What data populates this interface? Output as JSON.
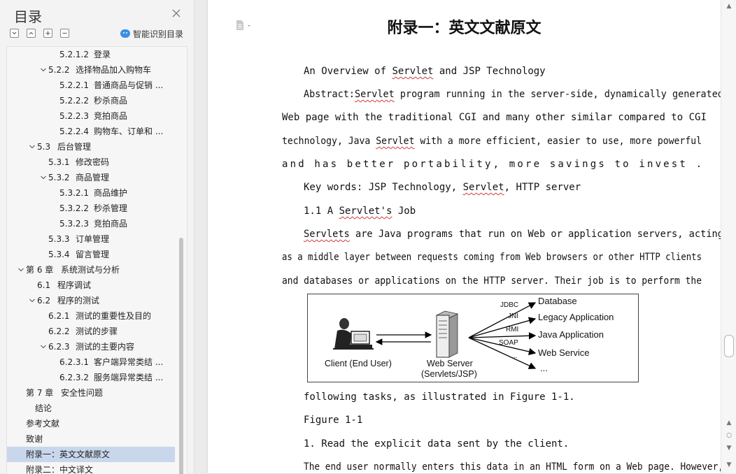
{
  "sidebar": {
    "title": "目录",
    "close_icon": "close-icon",
    "smart_toc_label": "智能识别目录",
    "toolbar_icons": [
      "collapse-all-icon",
      "expand-all-icon",
      "add-heading-icon",
      "remove-heading-icon"
    ],
    "items": [
      {
        "num": "5.2.1.2",
        "label": "登录",
        "level": 4,
        "chevron": ""
      },
      {
        "num": "5.2.2",
        "label": "选择物品加入购物车",
        "level": 3,
        "chevron": "down"
      },
      {
        "num": "5.2.2.1",
        "label": "普通商品与促销 ...",
        "level": 4,
        "chevron": ""
      },
      {
        "num": "5.2.2.2",
        "label": "秒杀商品",
        "level": 4,
        "chevron": ""
      },
      {
        "num": "5.2.2.3",
        "label": "竞拍商品",
        "level": 4,
        "chevron": ""
      },
      {
        "num": "5.2.2.4",
        "label": "购物车、订单和 ...",
        "level": 4,
        "chevron": ""
      },
      {
        "num": "5.3",
        "label": "后台管理",
        "level": 2,
        "chevron": "down"
      },
      {
        "num": "5.3.1",
        "label": "修改密码",
        "level": 3,
        "chevron": ""
      },
      {
        "num": "5.3.2",
        "label": "商品管理",
        "level": 3,
        "chevron": "down"
      },
      {
        "num": "5.3.2.1",
        "label": "商品维护",
        "level": 4,
        "chevron": ""
      },
      {
        "num": "5.3.2.2",
        "label": "秒杀管理",
        "level": 4,
        "chevron": ""
      },
      {
        "num": "5.3.2.3",
        "label": "竞拍商品",
        "level": 4,
        "chevron": ""
      },
      {
        "num": "5.3.3",
        "label": "订单管理",
        "level": 3,
        "chevron": ""
      },
      {
        "num": "5.3.4",
        "label": "留言管理",
        "level": 3,
        "chevron": ""
      },
      {
        "num": "第 6 章",
        "label": "系统测试与分析",
        "level": 1,
        "chevron": "down"
      },
      {
        "num": "6.1",
        "label": "程序调试",
        "level": 2,
        "chevron": ""
      },
      {
        "num": "6.2",
        "label": "程序的测试",
        "level": 2,
        "chevron": "down"
      },
      {
        "num": "6.2.1",
        "label": "测试的重要性及目的",
        "level": 3,
        "chevron": ""
      },
      {
        "num": "6.2.2",
        "label": "测试的步骤",
        "level": 3,
        "chevron": ""
      },
      {
        "num": "6.2.3",
        "label": "测试的主要内容",
        "level": 3,
        "chevron": "down"
      },
      {
        "num": "6.2.3.1",
        "label": "客户端异常类结 ...",
        "level": 4,
        "chevron": ""
      },
      {
        "num": "6.2.3.2",
        "label": "服务端异常类结 ...",
        "level": 4,
        "chevron": ""
      },
      {
        "num": "第 7 章",
        "label": "安全性问题",
        "level": 1,
        "chevron": ""
      },
      {
        "num": "",
        "label": "结论",
        "level": "1b",
        "chevron": ""
      },
      {
        "num": "",
        "label": "参考文献",
        "level": 0,
        "chevron": ""
      },
      {
        "num": "",
        "label": "致谢",
        "level": 0,
        "chevron": ""
      },
      {
        "num": "",
        "label": "附录一：英文文献原文",
        "level": 0,
        "chevron": "",
        "active": true
      },
      {
        "num": "",
        "label": "附录二：中文译文",
        "level": 0,
        "chevron": ""
      }
    ]
  },
  "document": {
    "icon": "document-icon",
    "title": "附录一：英文文献原文",
    "lines": [
      [
        {
          "t": "An Overview of "
        },
        {
          "t": "Servlet",
          "sq": true
        },
        {
          "t": " and JSP Technology"
        }
      ],
      [
        {
          "t": "Abstract:"
        },
        {
          "t": "Servlet",
          "sq": true
        },
        {
          "t": " program running in the server-side, dynamically generated"
        }
      ],
      [
        {
          "t": "Web page with the traditional CGI and many other similar compared to CGI"
        }
      ],
      [
        {
          "t": "technology, Java "
        },
        {
          "t": "Servlet",
          "sq": true
        },
        {
          "t": " with a more efficient, easier to use, more powerful"
        }
      ],
      [
        {
          "t": "and has better portability, more savings to invest ."
        }
      ],
      [
        {
          "t": "Key words: JSP Technology, "
        },
        {
          "t": "Servlet",
          "sq": true
        },
        {
          "t": ", HTTP server"
        }
      ],
      [
        {
          "t": "1.1 A "
        },
        {
          "t": "Servlet's",
          "sq": true
        },
        {
          "t": " Job"
        }
      ],
      [
        {
          "t": "Servlets",
          "sq": true
        },
        {
          "t": " are Java programs that run on Web or application servers, acting"
        }
      ],
      [
        {
          "t": "as a middle layer between requests coming from Web browsers or other HTTP clients"
        }
      ],
      [
        {
          "t": "and databases or applications on the HTTP server. Their job is to perform the"
        }
      ],
      [
        {
          "t": "following tasks, as illustrated in Figure 1-1."
        }
      ],
      [
        {
          "t": "Figure 1-1"
        }
      ],
      [
        {
          "t": "1. Read the explicit data sent by the client."
        }
      ],
      [
        {
          "t": "The end user normally enters this data in an HTML form on a Web page. However,"
        }
      ]
    ],
    "figure": {
      "client_label": "Client (End User)",
      "server_label_1": "Web Server",
      "server_label_2": "(Servlets/JSP)",
      "targets": [
        "Database",
        "Legacy Application",
        "Java Application",
        "Web Service",
        "..."
      ],
      "protocols": [
        "JDBC",
        "JNI",
        "RMI",
        "SOAP",
        "..."
      ]
    }
  },
  "scrollbar": {
    "up_icon": "scroll-up-icon",
    "down_icon": "scroll-down-icon",
    "page_icon": "page-nav-icon"
  }
}
